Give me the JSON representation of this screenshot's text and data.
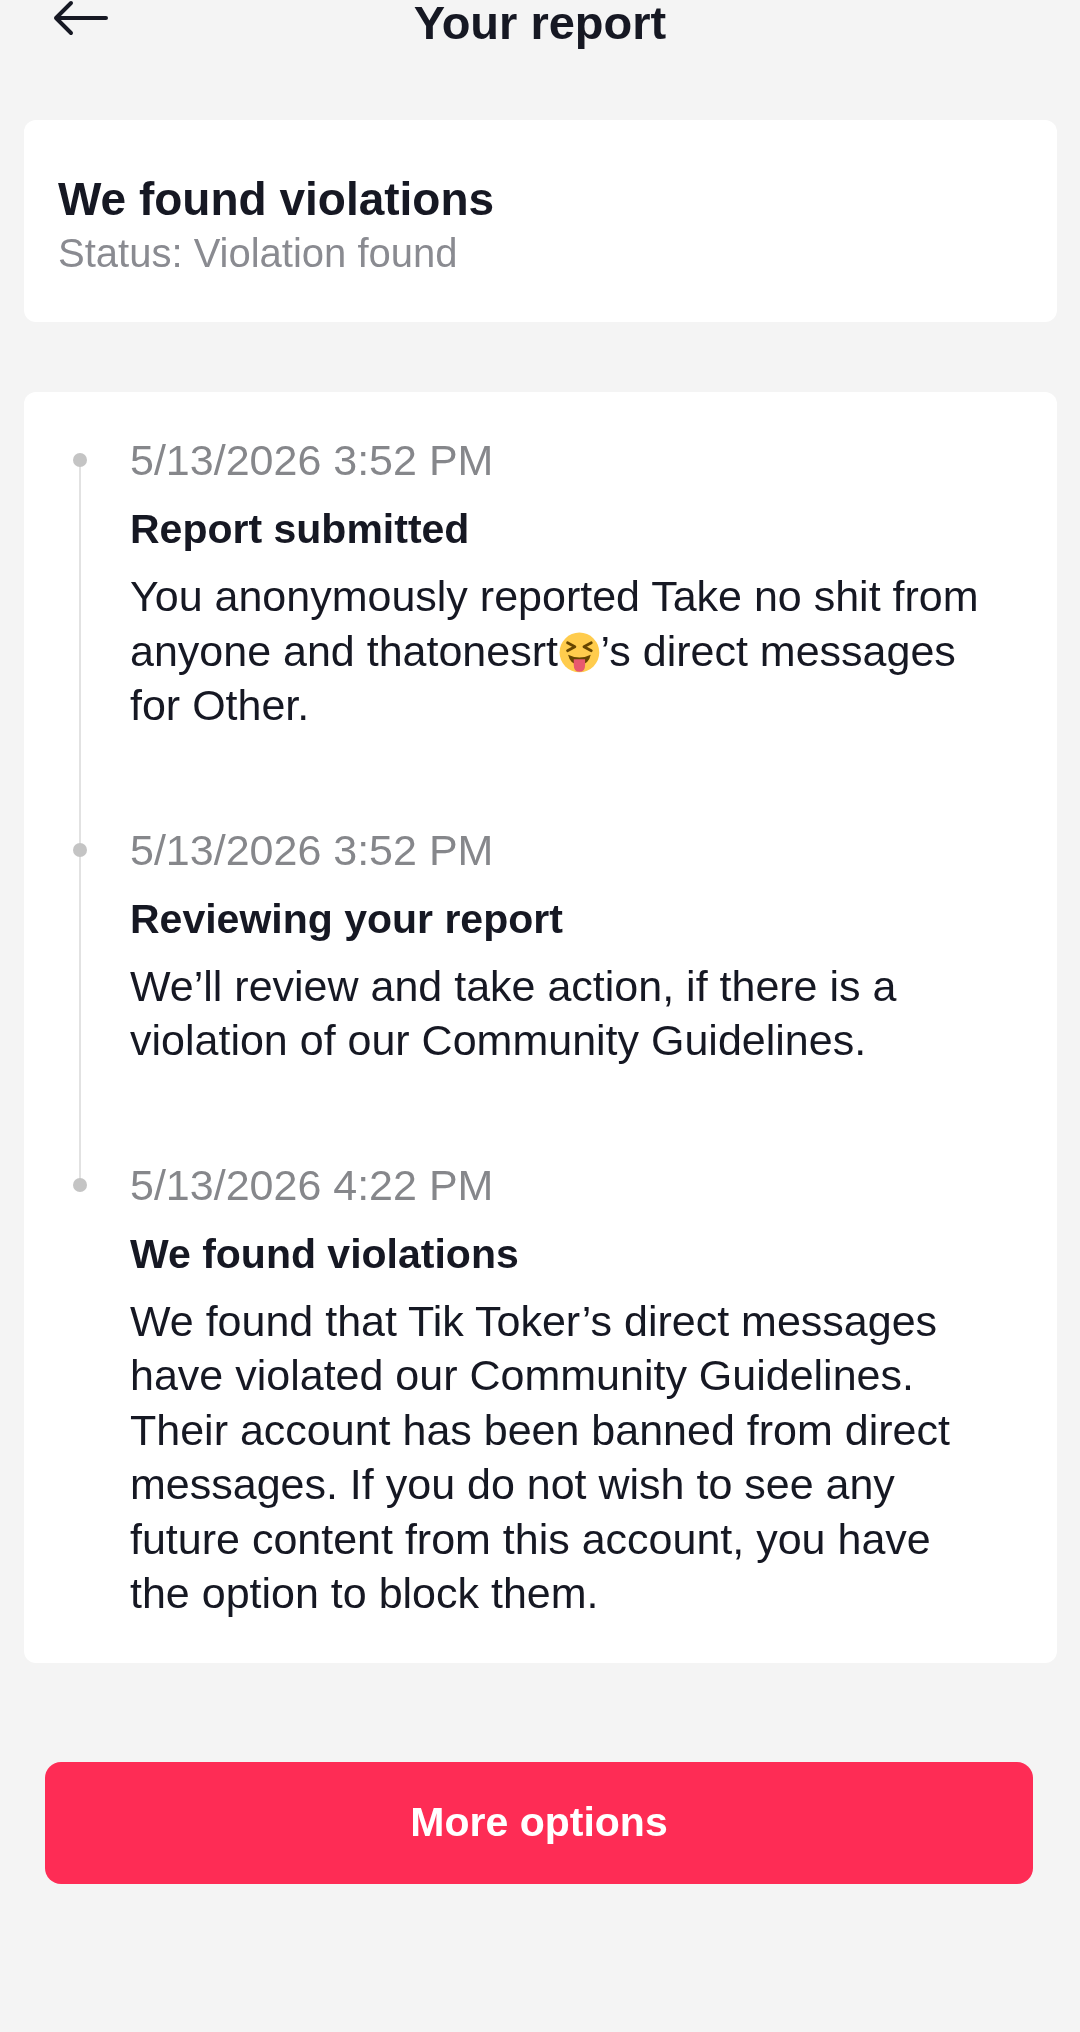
{
  "header": {
    "title": "Your report"
  },
  "summary": {
    "title": "We found violations",
    "status": "Status: Violation found"
  },
  "timeline": [
    {
      "time": "5/13/2026 3:52 PM",
      "title": "Report submitted",
      "description": [
        {
          "kind": "text",
          "text": "You anonymously reported Take no shit from anyone and thatonesrt"
        },
        {
          "kind": "emoji"
        },
        {
          "kind": "text",
          "text": "’s direct messages for Other."
        }
      ]
    },
    {
      "time": "5/13/2026 3:52 PM",
      "title": "Reviewing your report",
      "description": [
        {
          "kind": "text",
          "text": "We’ll review and take action, if there is a violation of our Community Guidelines."
        }
      ]
    },
    {
      "time": "5/13/2026 4:22 PM",
      "title": "We found violations",
      "description": [
        {
          "kind": "text",
          "text": "We found that Tik Toker’s direct messages have violated our Community Guidelines. Their account has been banned from direct messages. If you do not wish to see any future content from this account, you have the option to block them."
        }
      ]
    }
  ],
  "buttons": [
    {
      "label": "More options"
    }
  ]
}
